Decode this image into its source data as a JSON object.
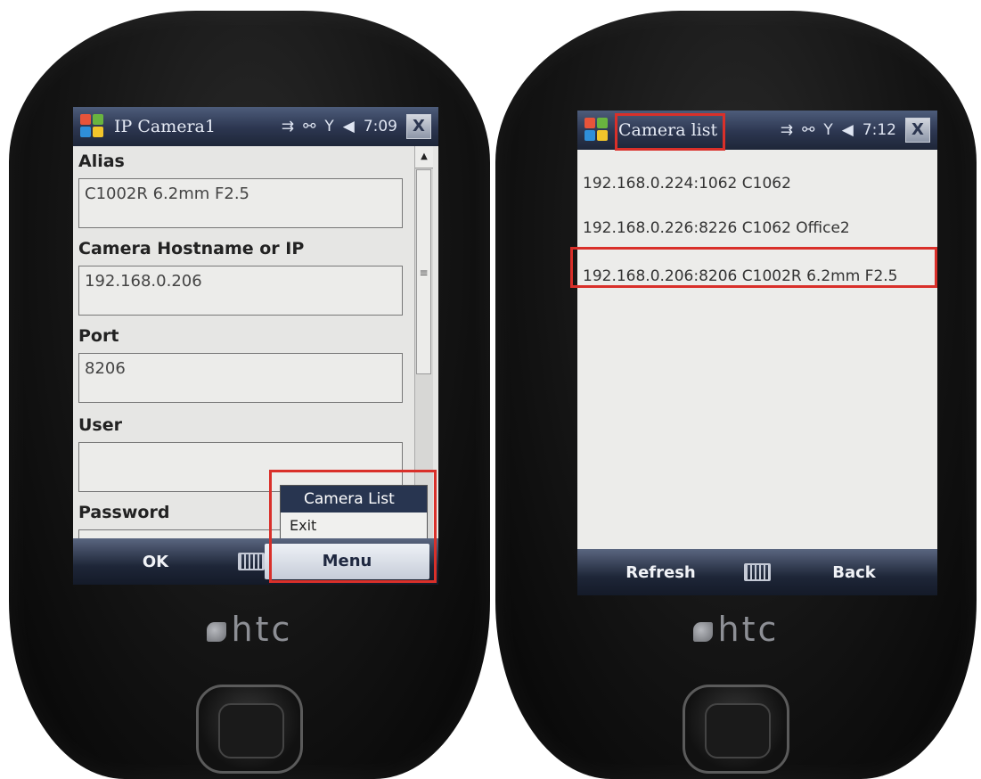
{
  "left_phone": {
    "titlebar": {
      "title": "IP Camera1",
      "time": "7:09",
      "close": "X"
    },
    "fields": [
      {
        "label": "Alias",
        "value": "C1002R 6.2mm F2.5"
      },
      {
        "label": "Camera Hostname or IP",
        "value": "192.168.0.206"
      },
      {
        "label": "Port",
        "value": "8206"
      },
      {
        "label": "User",
        "value": ""
      },
      {
        "label": "Password",
        "value": ""
      }
    ],
    "popup_menu": [
      "Camera List",
      "Exit"
    ],
    "softkeys": {
      "left": "OK",
      "right": "Menu"
    },
    "brand": "htc"
  },
  "right_phone": {
    "titlebar": {
      "title": "Camera list",
      "time": "7:12",
      "close": "X"
    },
    "cameras": [
      "192.168.0.224:1062 C1062",
      "192.168.0.226:8226 C1062 Office2",
      "192.168.0.206:8206 C1002R 6.2mm F2.5"
    ],
    "softkeys": {
      "left": "Refresh",
      "right": "Back"
    },
    "brand": "htc"
  },
  "colors": {
    "annotation_red": "#d9302a",
    "titlebar": "#2c3650",
    "selected_menu": "#283550"
  }
}
